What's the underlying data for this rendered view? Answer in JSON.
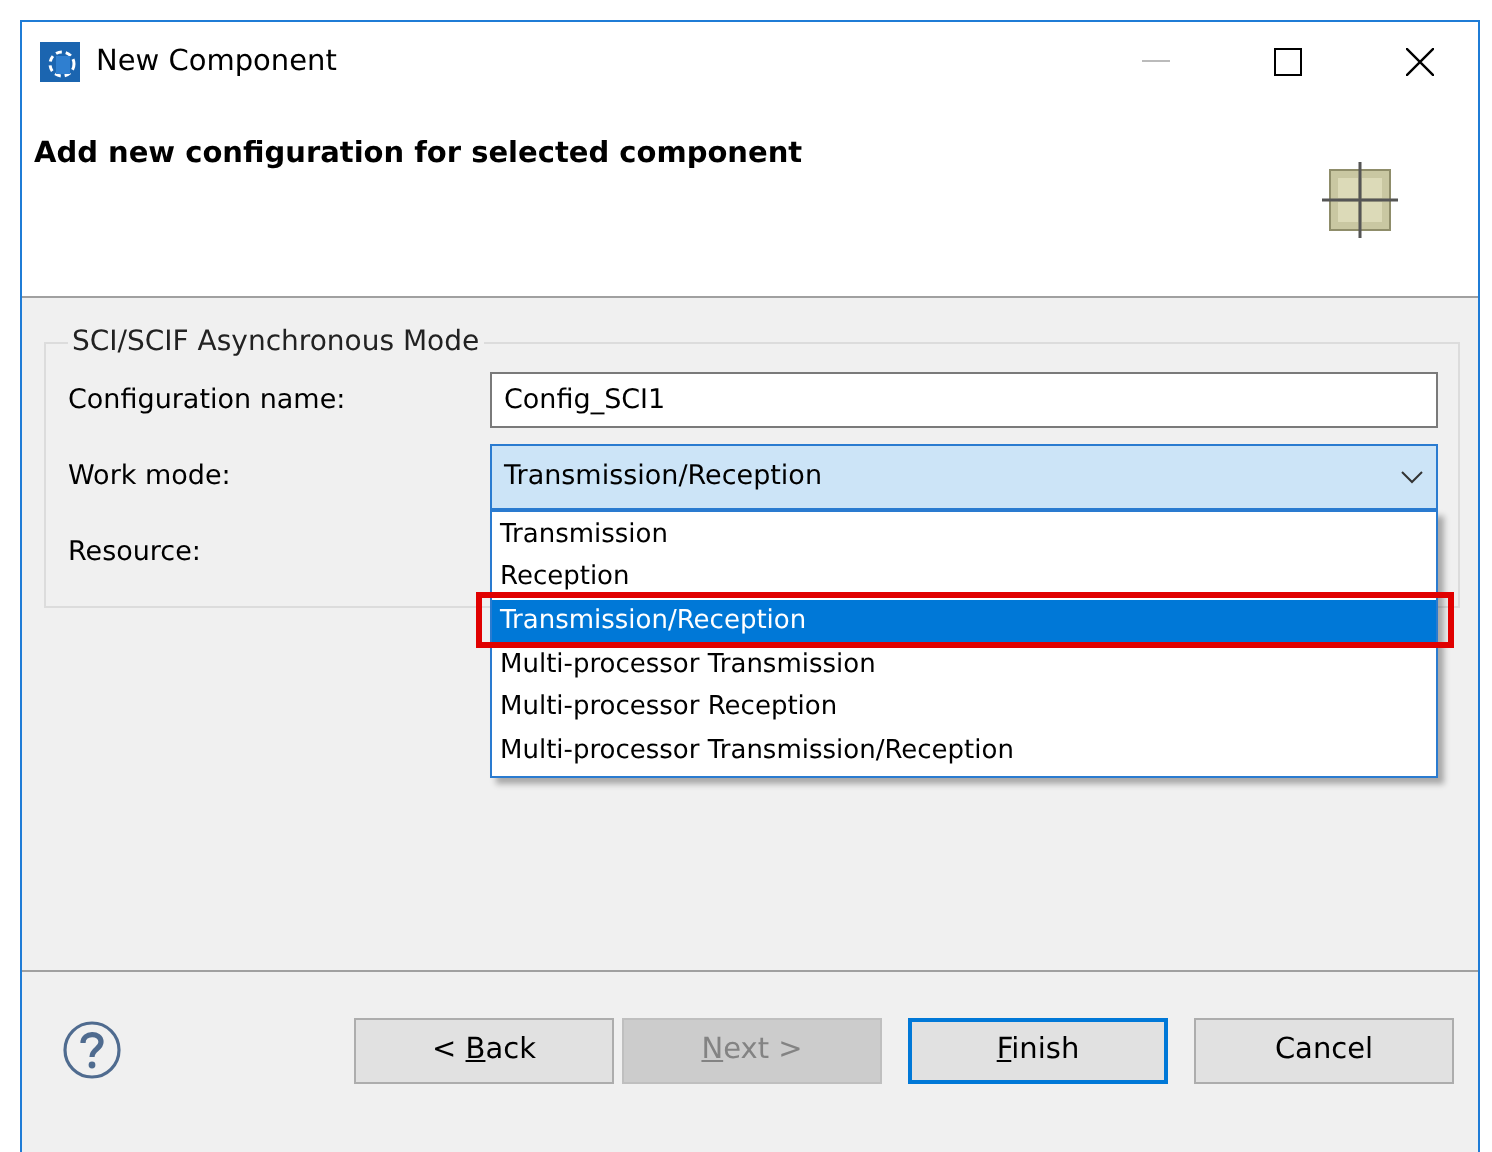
{
  "window": {
    "title": "New Component"
  },
  "header": {
    "title": "Add new configuration for selected component"
  },
  "group": {
    "title": "SCI/SCIF Asynchronous Mode",
    "configuration_name": {
      "label": "Configuration name:",
      "value": "Config_SCI1"
    },
    "work_mode": {
      "label": "Work mode:",
      "value": "Transmission/Reception",
      "expanded": true,
      "options": [
        {
          "label": "Transmission",
          "selected": false,
          "highlighted": false
        },
        {
          "label": "Reception",
          "selected": false,
          "highlighted": false
        },
        {
          "label": "Transmission/Reception",
          "selected": true,
          "highlighted": true
        },
        {
          "label": "Multi-processor Transmission",
          "selected": false,
          "highlighted": false
        },
        {
          "label": "Multi-processor Reception",
          "selected": false,
          "highlighted": false
        },
        {
          "label": "Multi-processor Transmission/Reception",
          "selected": false,
          "highlighted": false
        }
      ]
    },
    "resource": {
      "label": "Resource:"
    }
  },
  "buttons": [
    {
      "before": "< ",
      "mnemonic": "B",
      "after": "ack",
      "disabled": false,
      "default": false
    },
    {
      "mnemonic": "N",
      "after": "ext >",
      "disabled": true,
      "default": false
    },
    {
      "mnemonic": "F",
      "after": "inish",
      "disabled": false,
      "default": true
    },
    {
      "before": "Cancel",
      "disabled": false,
      "default": false
    }
  ]
}
